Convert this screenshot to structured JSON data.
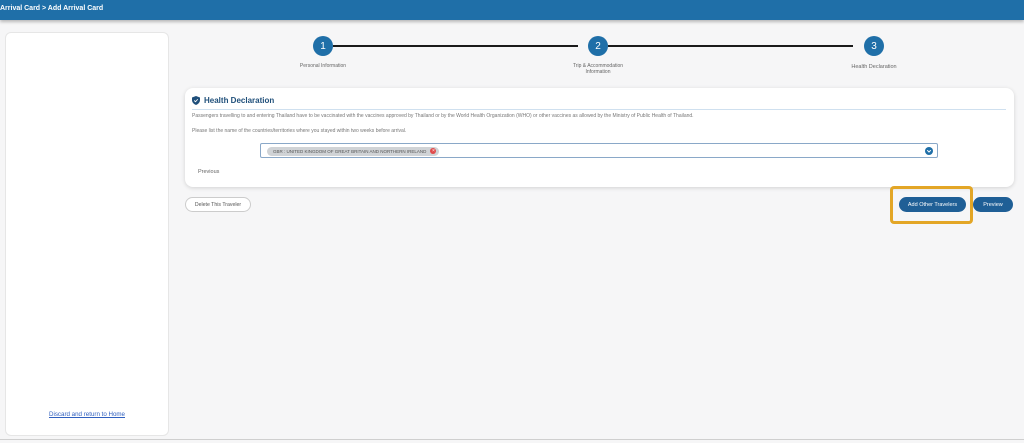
{
  "header": {
    "breadcrumb": "Arrival Card > Add Arrival Card",
    "bg_color": "#1f6fa8"
  },
  "sidebar": {
    "discard_link": "Discard and return to Home"
  },
  "stepper": {
    "steps": [
      {
        "number": "1",
        "label_lines": [
          "Personal Information"
        ]
      },
      {
        "number": "2",
        "label_lines": [
          "Trip & Accommodation",
          "Information"
        ]
      },
      {
        "number": "3",
        "label_lines": [
          "Health Declaration"
        ]
      }
    ],
    "active_color": "#1f6fa8"
  },
  "health": {
    "title": "Health Declaration",
    "notice": "Passengers travelling to and entering Thailand have to be vaccinated with the vaccines approved by Thailand or by the World Health Organization (WHO) or other vaccines as allowed by the Ministry of Public Health of Thailand.",
    "prompt": "Please list the name of the countries/territories where you stayed within two weeks before arrival.",
    "selected_country": "GBR : UNITED KINGDOM OF GREAT BRITAIN AND NORTHERN IRELAND",
    "previous_link": "Previous"
  },
  "actions": {
    "delete_traveler": "Delete This Traveler",
    "add_other_travelers": "Add Other Travelers",
    "preview": "Preview",
    "highlight_color": "#e3a626"
  },
  "icons": {
    "heading": "shield-icon",
    "chip_remove": "close-icon",
    "dropdown": "chevron-down-icon"
  }
}
